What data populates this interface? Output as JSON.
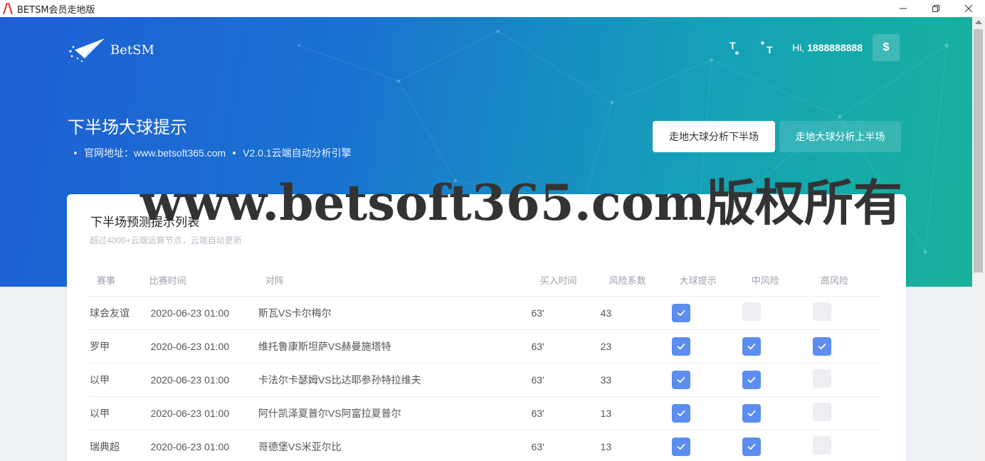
{
  "window": {
    "title": "BETSM会员走地版",
    "controls": [
      "minimize",
      "restore",
      "close"
    ]
  },
  "header": {
    "brand": "BetSM",
    "greeting_prefix": "Hi,",
    "username": "1888888888",
    "icons": [
      "text-size-icon",
      "text-size-icon",
      "dollar-icon"
    ],
    "dollar_label": "$"
  },
  "hero": {
    "title": "下半场大球提示",
    "site_label": "官网地址：www.betsoft365.com",
    "version_label": "V2.0.1云端自动分析引擎",
    "buttons": [
      "走地大球分析下半场",
      "走地大球分析上半场"
    ]
  },
  "watermark": "www.betsoft365.com版权所有",
  "card": {
    "title": "下半场预测提示列表",
    "subtitle": "超过4000+云端运算节点，云端自动更新",
    "columns": [
      "赛事",
      "比赛时间",
      "对阵",
      "买入时间",
      "风险系数",
      "大球提示",
      "中风险",
      "高风险"
    ],
    "rows": [
      {
        "event": "球会友谊",
        "time": "2020-06-23 01:00",
        "match": "斯瓦VS卡尔梅尔",
        "buy": "63'",
        "risk": "43",
        "big": true,
        "mid": false,
        "high": false
      },
      {
        "event": "罗甲",
        "time": "2020-06-23 01:00",
        "match": "维托鲁康斯坦萨VS赫曼施塔特",
        "buy": "63'",
        "risk": "23",
        "big": true,
        "mid": true,
        "high": true
      },
      {
        "event": "以甲",
        "time": "2020-06-23 01:00",
        "match": "卡法尔卡瑟姆VS比达耶参孙特拉维夫",
        "buy": "63'",
        "risk": "33",
        "big": true,
        "mid": true,
        "high": false
      },
      {
        "event": "以甲",
        "time": "2020-06-23 01:00",
        "match": "阿什凯泽夏普尔VS阿富拉夏普尔",
        "buy": "63'",
        "risk": "13",
        "big": true,
        "mid": true,
        "high": false
      },
      {
        "event": "瑞典超",
        "time": "2020-06-23 01:00",
        "match": "哥德堡VS米亚尔比",
        "buy": "63'",
        "risk": "13",
        "big": true,
        "mid": true,
        "high": false
      }
    ]
  },
  "colors": {
    "checkbox_on": "#5c8df1",
    "checkbox_off": "#eceef2",
    "hero_start": "#1e5fd6",
    "hero_end": "#17b29a"
  }
}
